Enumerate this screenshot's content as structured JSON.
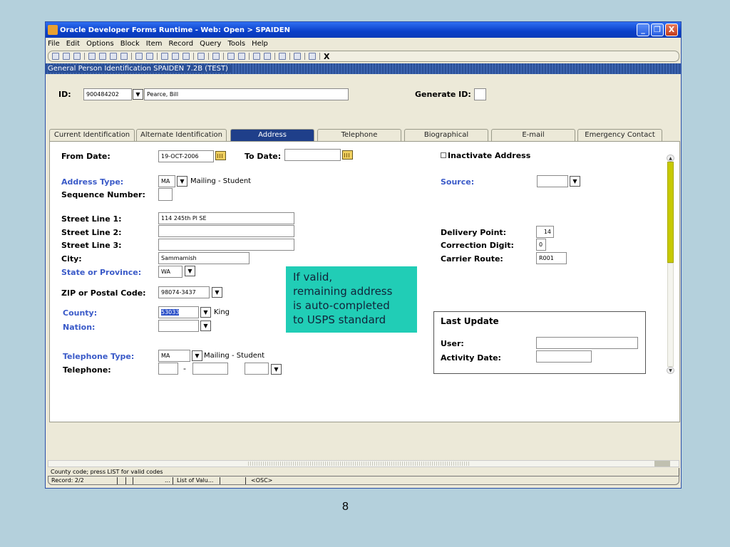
{
  "window": {
    "title": "Oracle Developer Forms Runtime - Web:  Open > SPAIDEN",
    "minimize_glyph": "_",
    "maximize_glyph": "❐",
    "close_glyph": "X"
  },
  "menu": [
    "File",
    "Edit",
    "Options",
    "Block",
    "Item",
    "Record",
    "Query",
    "Tools",
    "Help"
  ],
  "toolbar": {
    "close_label": "X"
  },
  "form_title": "General Person Identification  SPAIDEN  7.2B  (TEST)",
  "key_block": {
    "id_label": "ID:",
    "id_value": "900484202",
    "name_value": "Pearce, Bill",
    "generate_id_label": "Generate ID:"
  },
  "tabs": [
    {
      "label": "Current Identification",
      "active": false
    },
    {
      "label": "Alternate Identification",
      "active": false
    },
    {
      "label": "Address",
      "active": true
    },
    {
      "label": "Telephone",
      "active": false
    },
    {
      "label": "Biographical",
      "active": false
    },
    {
      "label": "E-mail",
      "active": false
    },
    {
      "label": "Emergency Contact",
      "active": false
    }
  ],
  "address": {
    "from_date_label": "From Date:",
    "from_date_value": "19-OCT-2006",
    "to_date_label": "To Date:",
    "to_date_value": "",
    "inactivate_label": "Inactivate Address",
    "address_type_label": "Address Type:",
    "address_type_code": "MA",
    "address_type_desc": "Mailing - Student",
    "source_label": "Source:",
    "source_value": "",
    "sequence_label": "Sequence Number:",
    "sequence_value": "",
    "street1_label": "Street Line 1:",
    "street1_value": "114 245th Pl SE",
    "street2_label": "Street Line 2:",
    "street2_value": "",
    "street3_label": "Street Line 3:",
    "street3_value": "",
    "city_label": "City:",
    "city_value": "Sammamish",
    "state_label": "State or Province:",
    "state_value": "WA",
    "zip_label": "ZIP or Postal Code:",
    "zip_value": "98074-3437",
    "county_label": "County:",
    "county_code": "53033",
    "county_desc": "King",
    "nation_label": "Nation:",
    "nation_value": "",
    "delivery_point_label": "Delivery Point:",
    "delivery_point_value": "14",
    "correction_digit_label": "Correction Digit:",
    "correction_digit_value": "0",
    "carrier_route_label": "Carrier Route:",
    "carrier_route_value": "R001",
    "phone_type_label": "Telephone Type:",
    "phone_type_code": "MA",
    "phone_type_desc": "Mailing - Student",
    "telephone_label": "Telephone:",
    "phone_dash": "-"
  },
  "last_update": {
    "title": "Last Update",
    "user_label": "User:",
    "user_value": "",
    "activity_date_label": "Activity Date:",
    "activity_date_value": ""
  },
  "callout": {
    "line1": "If valid,",
    "line2": "remaining address",
    "line3": "is auto-completed",
    "line4": "to USPS standard"
  },
  "status": {
    "hint": "County code; press LIST for valid codes",
    "record": "Record: 2/2",
    "ellipsis": "...",
    "list_of_values": "List of Valu...",
    "osc": "<OSC>"
  },
  "page_number": "8"
}
